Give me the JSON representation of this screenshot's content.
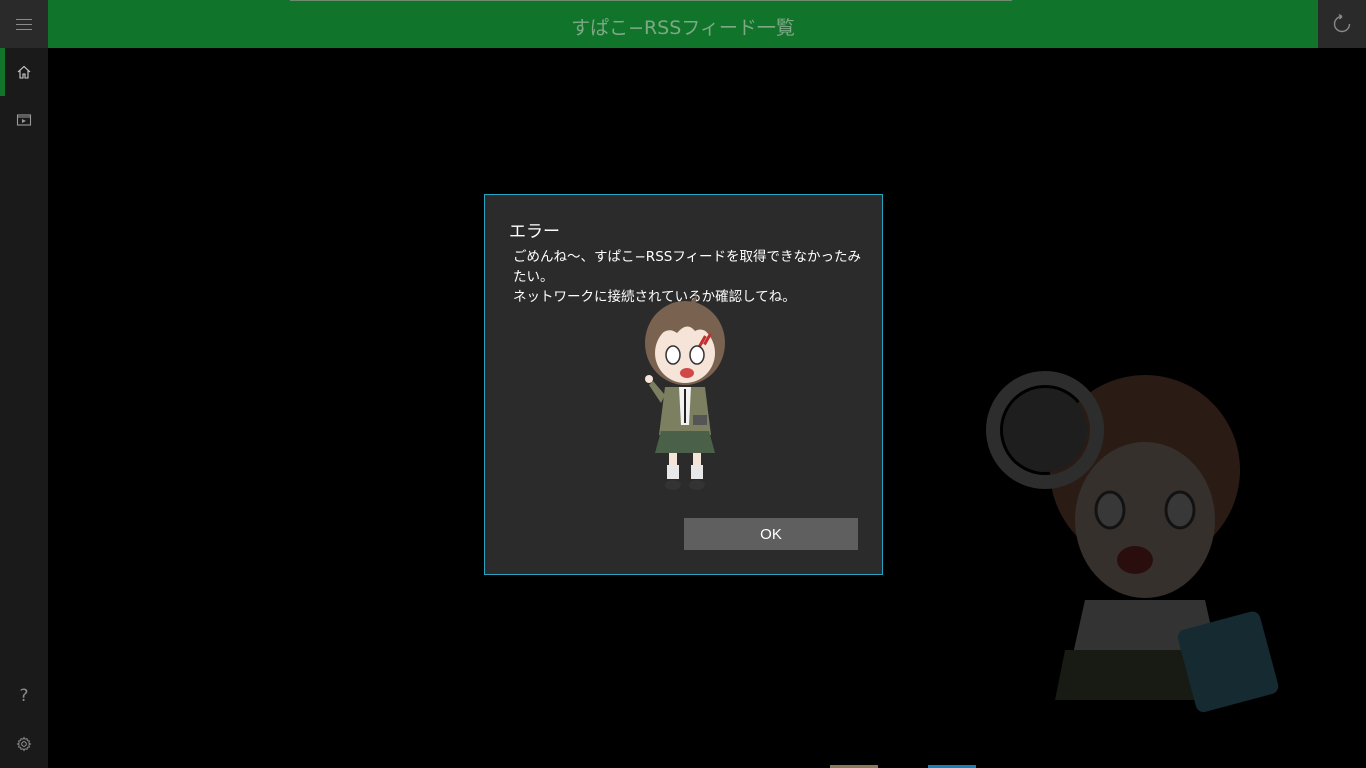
{
  "header": {
    "title": "すぱこ−RSSフィード一覧",
    "menu_icon": "hamburger-icon",
    "refresh_icon": "refresh-icon"
  },
  "nav": {
    "items": [
      {
        "icon": "home-icon",
        "active": true
      },
      {
        "icon": "video-icon",
        "active": false
      }
    ],
    "bottom": [
      {
        "icon": "help-icon",
        "glyph": "?"
      },
      {
        "icon": "gear-icon"
      }
    ]
  },
  "dialog": {
    "title": "エラー",
    "message_line1": "ごめんね〜、すぱこ−RSSフィードを取得できなかったみたい。",
    "message_line2": "ネットワークに接続されているか確認してね。",
    "ok_label": "OK"
  },
  "colors": {
    "accent": "#10742a",
    "dialog_border": "#2aa3c3",
    "dialog_bg": "#2b2b2b"
  }
}
